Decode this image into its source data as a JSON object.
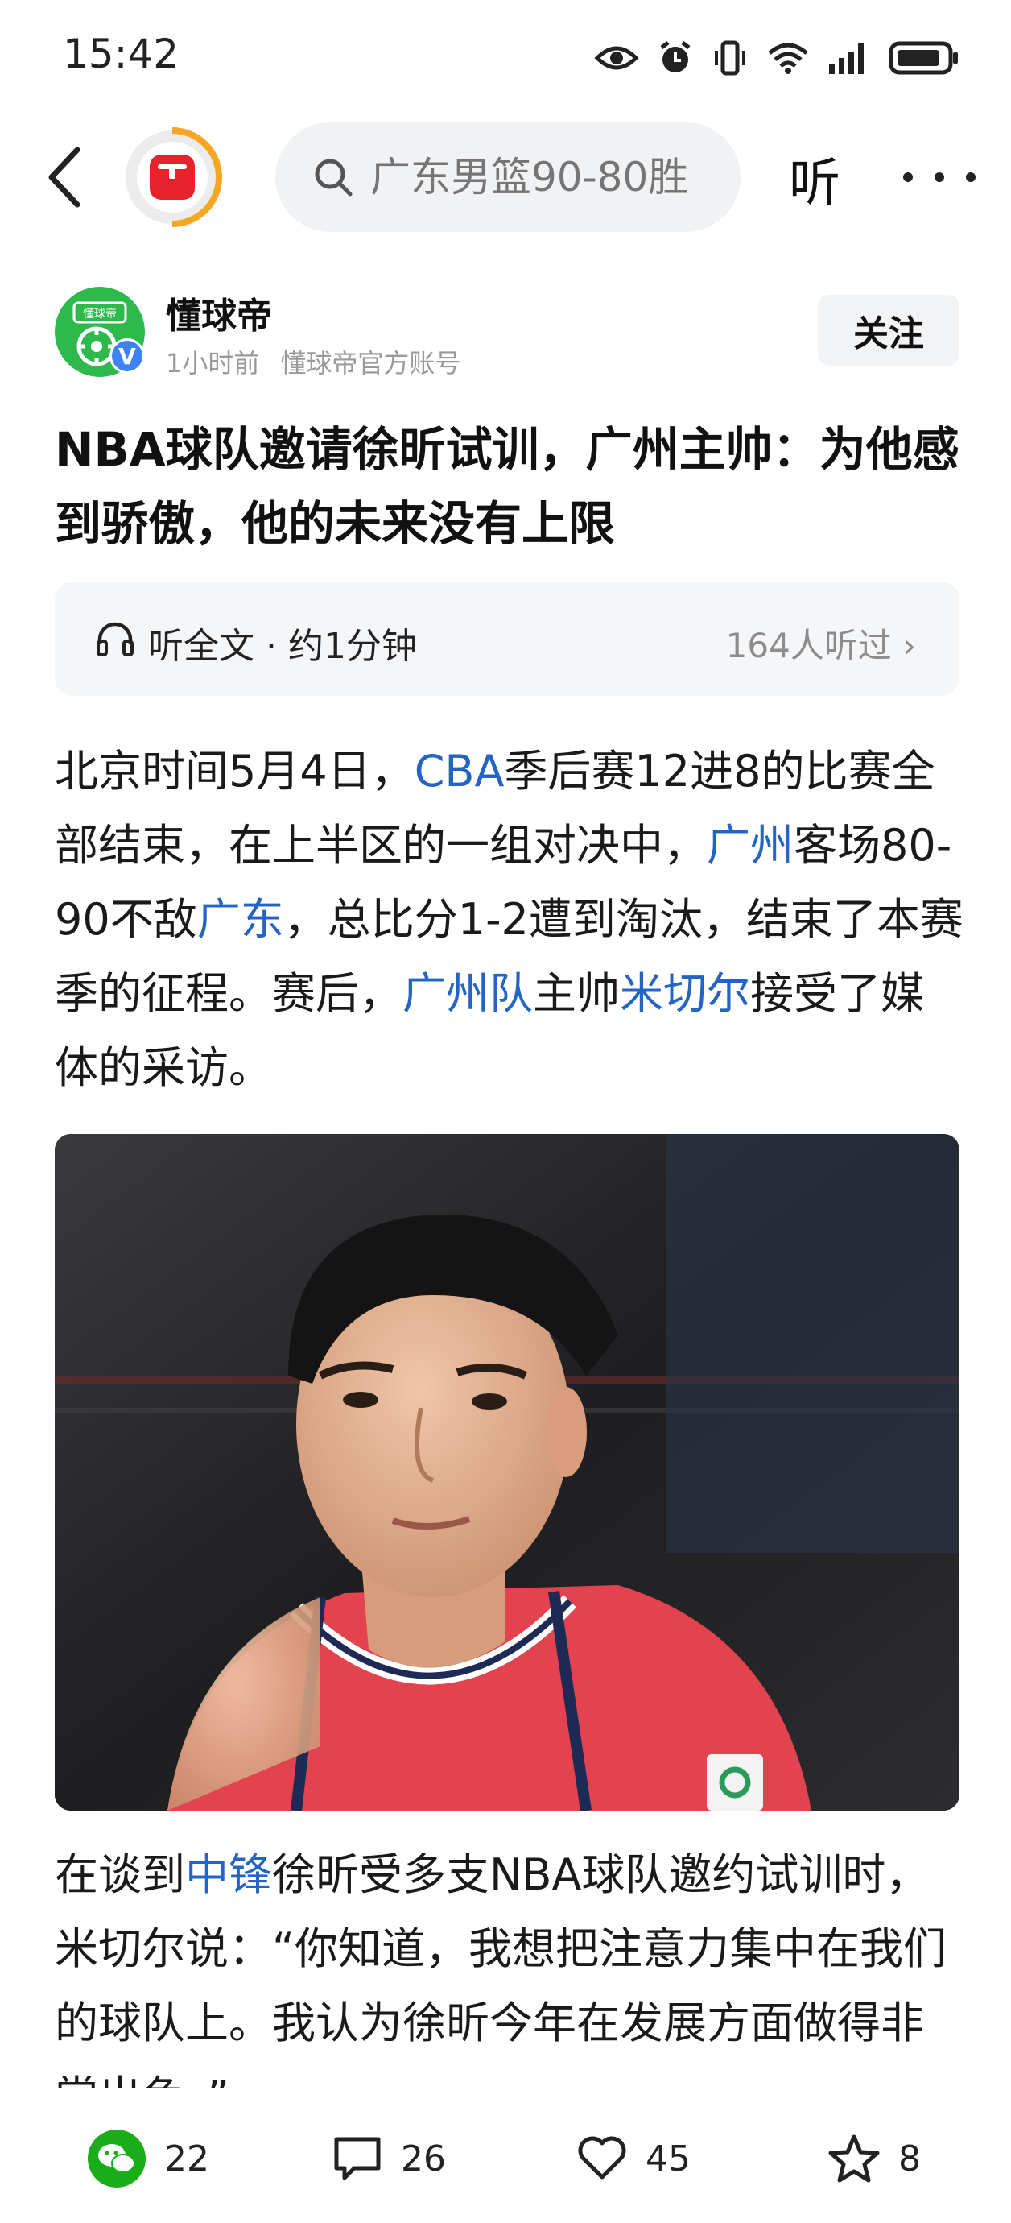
{
  "status_bar": {
    "time": "15:42"
  },
  "top_nav": {
    "search_placeholder": "广东男篮90-80胜",
    "listen_label": "听"
  },
  "author": {
    "name": "懂球帝",
    "time": "1小时前",
    "account": "懂球帝官方账号",
    "avatar_text": "懂球帝",
    "verified": "V",
    "follow_label": "关注"
  },
  "article": {
    "title": "NBA球队邀请徐昕试训，广州主帅：为他感到骄傲，他的未来没有上限",
    "listen_full": "听全文 · 约1分钟",
    "listen_count": "164人听过",
    "para1": [
      "北京时间5月4日，",
      "CBA",
      "季后赛12进8的比赛全部结束，在上半区的一组对决中，",
      "广州",
      "客场80-90不敌",
      "广东",
      "，总比分1-2遭到淘汰，结束了本赛季的征程。赛后，",
      "广州队",
      "主帅",
      "米切尔",
      "接受了媒体的采访。"
    ],
    "para2": [
      "在谈到",
      "中锋",
      "徐昕受多支NBA球队邀约试训时，米切尔说：“你知道，我想把注意力集中在我们的球队上。我认为徐昕今年在发展方面做得非常出色。”"
    ]
  },
  "actions": {
    "share_count": "22",
    "comment_count": "26",
    "like_count": "45",
    "favorite_count": "8"
  },
  "colors": {
    "link": "#2464c4",
    "wechat_green": "#1aad19",
    "logo_red": "#e8222b",
    "logo_orange": "#f6a623"
  }
}
